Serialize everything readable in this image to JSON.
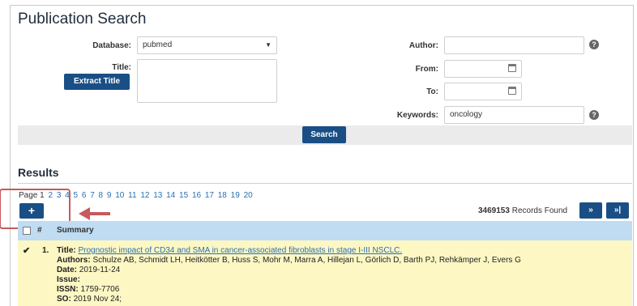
{
  "page": {
    "title": "Publication Search"
  },
  "form": {
    "database_label": "Database:",
    "database_value": "pubmed",
    "title_label": "Title:",
    "extract_title_button": "Extract Title",
    "title_value": "",
    "author_label": "Author:",
    "author_value": "",
    "from_label": "From:",
    "from_value": "",
    "to_label": "To:",
    "to_value": "",
    "keywords_label": "Keywords:",
    "keywords_value": "oncology",
    "search_button": "Search"
  },
  "results": {
    "heading": "Results",
    "page_label": "Page",
    "current_page": "1",
    "pages": [
      "2",
      "3",
      "4",
      "5",
      "6",
      "7",
      "8",
      "9",
      "10",
      "11",
      "12",
      "13",
      "14",
      "15",
      "16",
      "17",
      "18",
      "19",
      "20"
    ],
    "add_button": "+",
    "records_count": "3469153",
    "records_label": "Records Found",
    "next_button": "»",
    "last_button": "»|",
    "columns": {
      "number": "#",
      "summary": "Summary"
    },
    "rows": [
      {
        "number": "1.",
        "title_label": "Title:",
        "title": "Prognostic impact of CD34 and SMA in cancer-associated fibroblasts in stage I-III NSCLC.",
        "authors_label": "Authors:",
        "authors": "Schulze AB, Schmidt LH, Heitkötter B, Huss S, Mohr M, Marra A, Hillejan L, Görlich D, Barth PJ, Rehkämper J, Evers G",
        "date_label": "Date:",
        "date": "2019-11-24",
        "issue_label": "Issue:",
        "issue": "",
        "issn_label": "ISSN:",
        "issn": "1759-7706",
        "so_label": "SO:",
        "so": "2019 Nov 24;"
      }
    ]
  },
  "colors": {
    "primary": "#1a4f86",
    "highlight_row": "#fdf7c4",
    "table_header": "#bfdcf2",
    "annotation": "#c8595d",
    "link": "#2a6fb0"
  }
}
